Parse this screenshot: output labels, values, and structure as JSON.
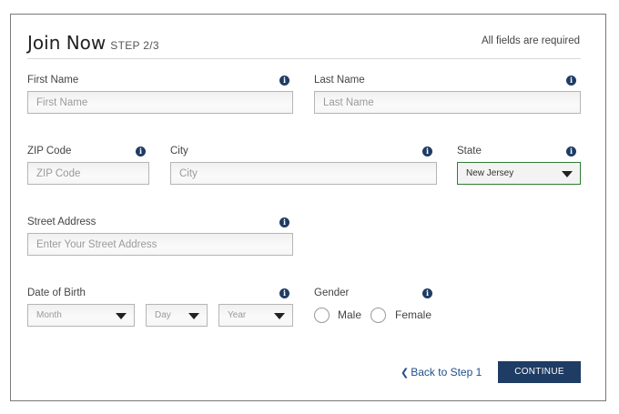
{
  "header": {
    "title": "Join Now",
    "step": "STEP 2/3",
    "required_note": "All fields are required"
  },
  "fields": {
    "first_name": {
      "label": "First Name",
      "placeholder": "First Name"
    },
    "last_name": {
      "label": "Last Name",
      "placeholder": "Last Name"
    },
    "zip": {
      "label": "ZIP Code",
      "placeholder": "ZIP Code"
    },
    "city": {
      "label": "City",
      "placeholder": "City"
    },
    "state": {
      "label": "State",
      "value": "New Jersey"
    },
    "street": {
      "label": "Street Address",
      "placeholder": "Enter Your Street Address"
    },
    "dob": {
      "label": "Date of Birth",
      "month": "Month",
      "day": "Day",
      "year": "Year"
    },
    "gender": {
      "label": "Gender",
      "options": [
        "Male",
        "Female"
      ]
    }
  },
  "info_glyph": "i",
  "actions": {
    "back_label": "Back to Step 1",
    "continue_label": "CONTINUE"
  },
  "colors": {
    "accent": "#1f3c64",
    "link": "#1f4e8c",
    "active_border": "#2e7d32"
  }
}
